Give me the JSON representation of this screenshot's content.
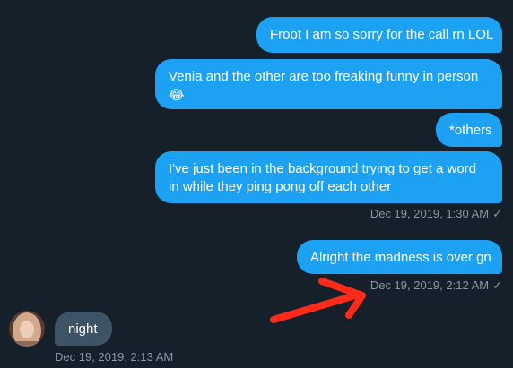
{
  "conversation": {
    "messages": [
      {
        "text": "Froot I am so sorry for the call rn LOL"
      },
      {
        "text": "Venia and the other are too freaking funny in person",
        "emoji": "😂"
      },
      {
        "text": "*others"
      },
      {
        "text": "I've just been in the background trying to get a word in while they ping pong off each other"
      },
      {
        "text": "Alright the madness is over gn"
      },
      {
        "text": "night"
      }
    ],
    "timestamps": {
      "t1": "Dec 19, 2019, 1:30 AM",
      "t2": "Dec 19, 2019, 2:12 AM",
      "t3": "Dec 19, 2019, 2:13 AM"
    },
    "read_check": "✓"
  },
  "annotation": {
    "arrow_color": "#ff2a1a"
  },
  "colors": {
    "background": "#15202b",
    "outgoing_bubble": "#1da1f2",
    "incoming_bubble": "#3d5466",
    "meta_text": "#8899a6"
  },
  "icons": {
    "avatar": "user-avatar-photo",
    "arrow": "red-annotation-arrow"
  }
}
